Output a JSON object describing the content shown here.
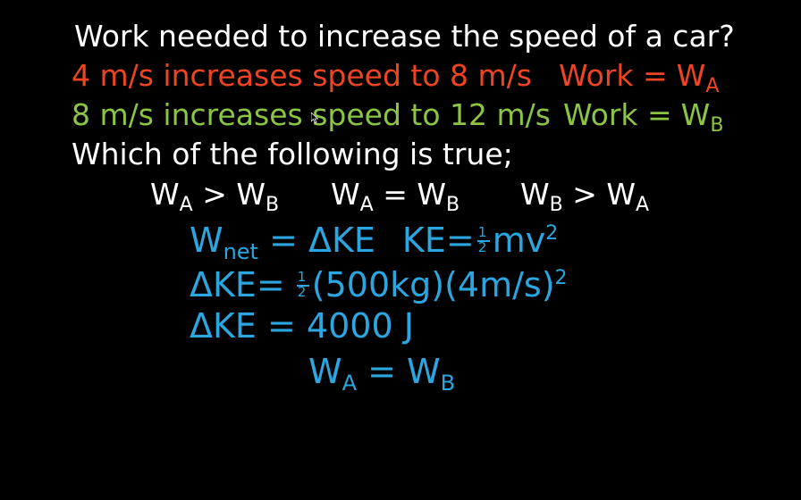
{
  "slide": {
    "title": "Work needed to increase the speed of a car?",
    "case_a": {
      "text": "4 m/s increases speed to 8 m/s",
      "work_label": "Work =",
      "work_var": "W",
      "work_sub": "A",
      "color": "#ee4422"
    },
    "case_b": {
      "text": "8 m/s increases speed to 12 m/s",
      "work_label": "Work =",
      "work_var": "W",
      "work_sub": "B",
      "color": "#8cc443"
    },
    "question": "Which of the following is true;",
    "options": [
      {
        "left": "W",
        "left_sub": "A",
        "op": ">",
        "right": "W",
        "right_sub": "B"
      },
      {
        "left": "W",
        "left_sub": "A",
        "op": "=",
        "right": "W",
        "right_sub": "B"
      },
      {
        "left": "W",
        "left_sub": "B",
        "op": ">",
        "right": "W",
        "right_sub": "A"
      }
    ],
    "solution": {
      "color": "#2ba6e0",
      "line1": {
        "var": "W",
        "sub": "net",
        "rest": "= ΔKE",
        "ke_label": "KE=",
        "frac_num": "1",
        "frac_den": "2",
        "formula": "mv",
        "exp": "2"
      },
      "line2": {
        "lhs": "ΔKE=",
        "frac_num": "1",
        "frac_den": "2",
        "expr": "(500kg)(4m/s)",
        "exp": "2"
      },
      "line3": "ΔKE = 4000 J",
      "line4": {
        "left": "W",
        "left_sub": "A",
        "op": "=",
        "right": "W",
        "right_sub": "B"
      }
    }
  }
}
